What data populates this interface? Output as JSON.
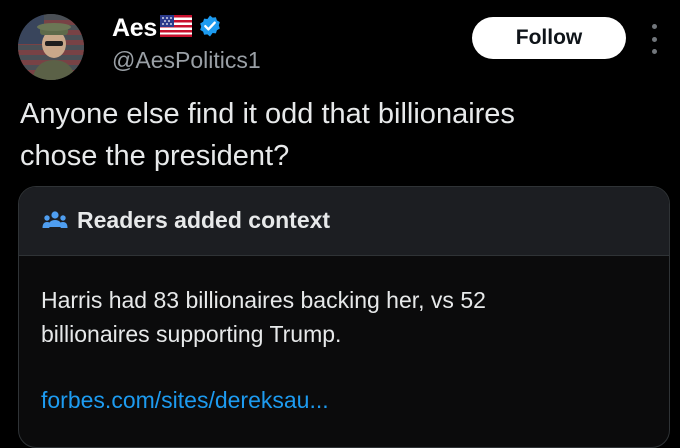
{
  "post": {
    "author": {
      "display_name": "Aes",
      "handle": "@AesPolitics1",
      "name_emoji_icon": "us-flag-icon",
      "verified_icon": "verified-badge-icon"
    },
    "follow_label": "Follow",
    "text_lines": [
      "Anyone else find it odd that billionaires",
      "chose the president?"
    ]
  },
  "context_note": {
    "icon": "readers-icon",
    "title": "Readers added context",
    "body_lines": [
      "Harris had 83 billionaires backing her, vs 52",
      "billionaires supporting Trump."
    ],
    "link": "forbes.com/sites/dereksau..."
  },
  "colors": {
    "background": "#000000",
    "text": "#e7e9ea",
    "secondary_text": "#9aa0a6",
    "link": "#1d9bf0",
    "verified": "#1d9bf0",
    "card_header": "#1c1e22",
    "card_border": "#2f3336"
  }
}
